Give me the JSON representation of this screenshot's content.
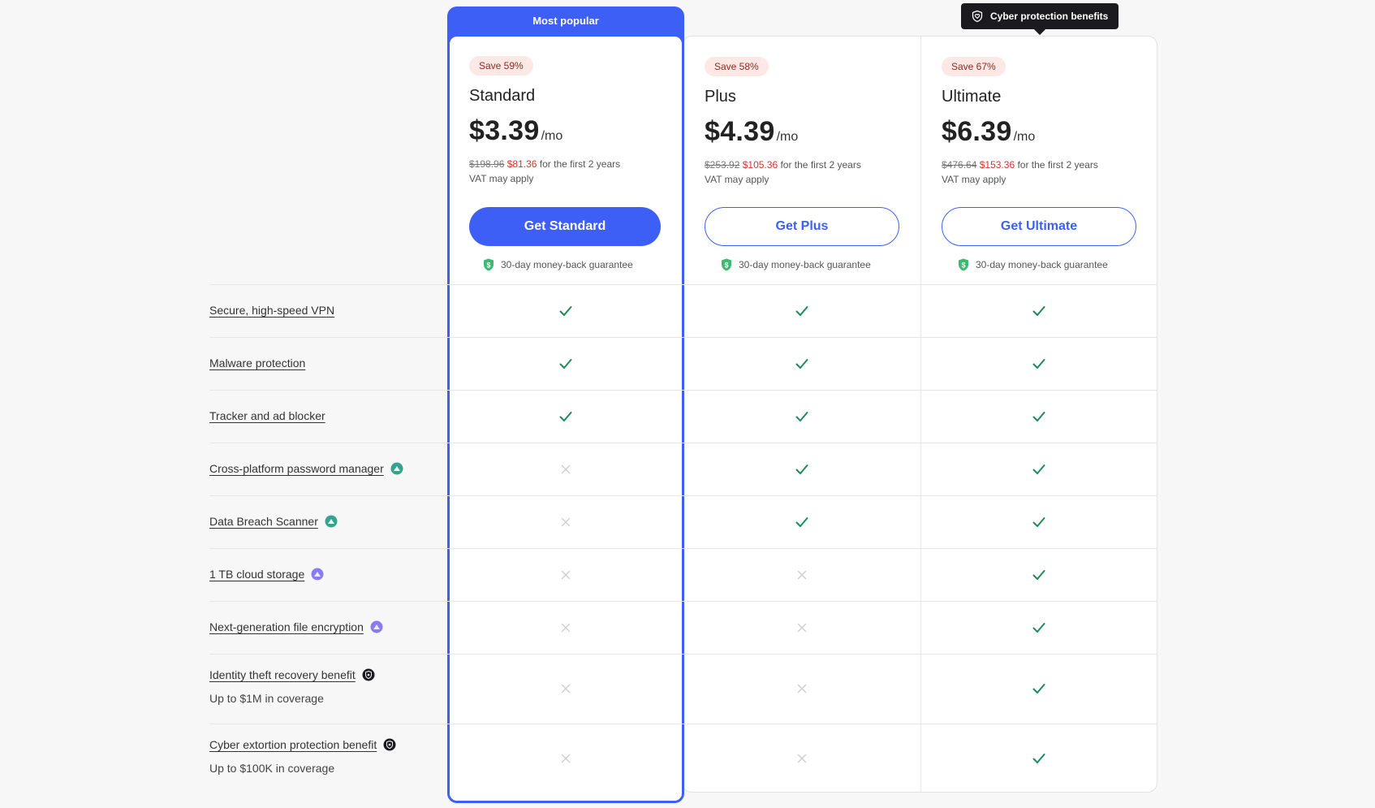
{
  "featured_label": "Most popular",
  "tooltip": {
    "label": "Cyber protection benefits",
    "icon": "shield-heart-icon"
  },
  "colors": {
    "accent": "#3e5ff6",
    "check": "#1f8a5b",
    "cross": "#cfcfd4",
    "sale": "#d1342b"
  },
  "plans": [
    {
      "save": "Save 59%",
      "name": "Standard",
      "price": "$3.39",
      "per": "/mo",
      "old_price": "$198.96",
      "new_price": "$81.36",
      "term": " for the first 2 years",
      "vat": "VAT may apply",
      "cta": "Get Standard",
      "guarantee": "30-day money-back guarantee"
    },
    {
      "save": "Save 58%",
      "name": "Plus",
      "price": "$4.39",
      "per": "/mo",
      "old_price": "$253.92",
      "new_price": "$105.36",
      "term": " for the first 2 years",
      "vat": "VAT may apply",
      "cta": "Get Plus",
      "guarantee": "30-day money-back guarantee"
    },
    {
      "save": "Save 67%",
      "name": "Ultimate",
      "price": "$6.39",
      "per": "/mo",
      "old_price": "$476.64",
      "new_price": "$153.36",
      "term": " for the first 2 years",
      "vat": "VAT may apply",
      "cta": "Get Ultimate",
      "guarantee": "30-day money-back guarantee"
    }
  ],
  "features": [
    {
      "label": "Secure, high-speed VPN",
      "sub": "",
      "icon": "",
      "included": [
        true,
        true,
        true
      ]
    },
    {
      "label": "Malware protection",
      "sub": "",
      "icon": "",
      "included": [
        true,
        true,
        true
      ]
    },
    {
      "label": "Tracker and ad blocker",
      "sub": "",
      "icon": "",
      "included": [
        true,
        true,
        true
      ]
    },
    {
      "label": "Cross-platform password manager",
      "sub": "",
      "icon": "password-manager-icon",
      "included": [
        false,
        true,
        true
      ]
    },
    {
      "label": "Data Breach Scanner",
      "sub": "",
      "icon": "password-manager-icon",
      "included": [
        false,
        true,
        true
      ]
    },
    {
      "label": "1 TB cloud storage",
      "sub": "",
      "icon": "cloud-storage-icon",
      "included": [
        false,
        false,
        true
      ]
    },
    {
      "label": "Next-generation file encryption",
      "sub": "",
      "icon": "cloud-storage-icon",
      "included": [
        false,
        false,
        true
      ]
    },
    {
      "label": "Identity theft recovery benefit",
      "sub": "Up to $1M in coverage",
      "icon": "cyber-shield-icon",
      "included": [
        false,
        false,
        true
      ]
    },
    {
      "label": "Cyber extortion protection benefit",
      "sub": "Up to $100K in coverage",
      "icon": "cyber-shield-icon",
      "included": [
        false,
        false,
        true
      ]
    }
  ]
}
